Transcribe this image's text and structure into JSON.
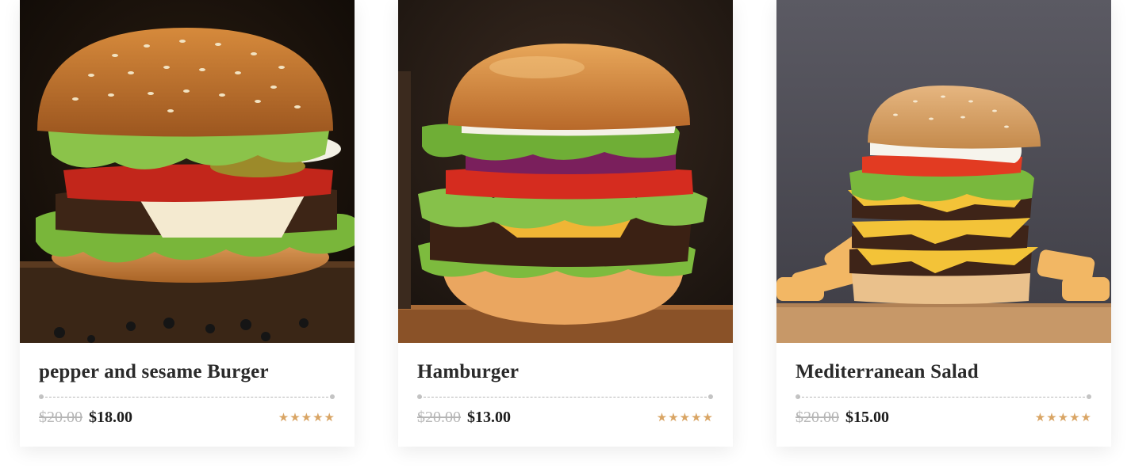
{
  "products": [
    {
      "name": "pepper and sesame Burger",
      "old_price": "$20.00",
      "price": "$18.00",
      "rating": 5,
      "star_icon": "star-icon",
      "star_color": "#d9a565"
    },
    {
      "name": "Hamburger",
      "old_price": "$20.00",
      "price": "$13.00",
      "rating": 5,
      "star_icon": "star-icon",
      "star_color": "#d9a565"
    },
    {
      "name": "Mediterranean Salad",
      "old_price": "$20.00",
      "price": "$15.00",
      "rating": 5,
      "star_icon": "star-icon",
      "star_color": "#d9a565"
    }
  ]
}
